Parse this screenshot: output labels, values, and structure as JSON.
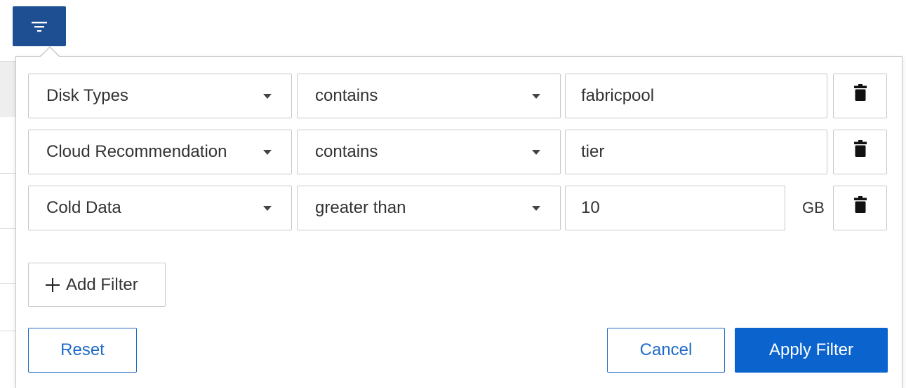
{
  "colors": {
    "toggle_bg": "#1f4f93",
    "primary": "#0b63ce",
    "outline_button": "#1f6bc7",
    "border": "#c8c8c8"
  },
  "filter_toggle": {
    "icon": "filter-icon"
  },
  "filters": [
    {
      "field": "Disk Types",
      "operator": "contains",
      "value": "fabricpool",
      "unit": ""
    },
    {
      "field": "Cloud Recommendation",
      "operator": "contains",
      "value": "tier",
      "unit": ""
    },
    {
      "field": "Cold Data",
      "operator": "greater than",
      "value": "10",
      "unit": "GB"
    }
  ],
  "delete_icon": "trash-icon",
  "add_filter": {
    "icon": "plus-icon",
    "label": "Add Filter"
  },
  "actions": {
    "reset": "Reset",
    "cancel": "Cancel",
    "apply": "Apply Filter"
  }
}
